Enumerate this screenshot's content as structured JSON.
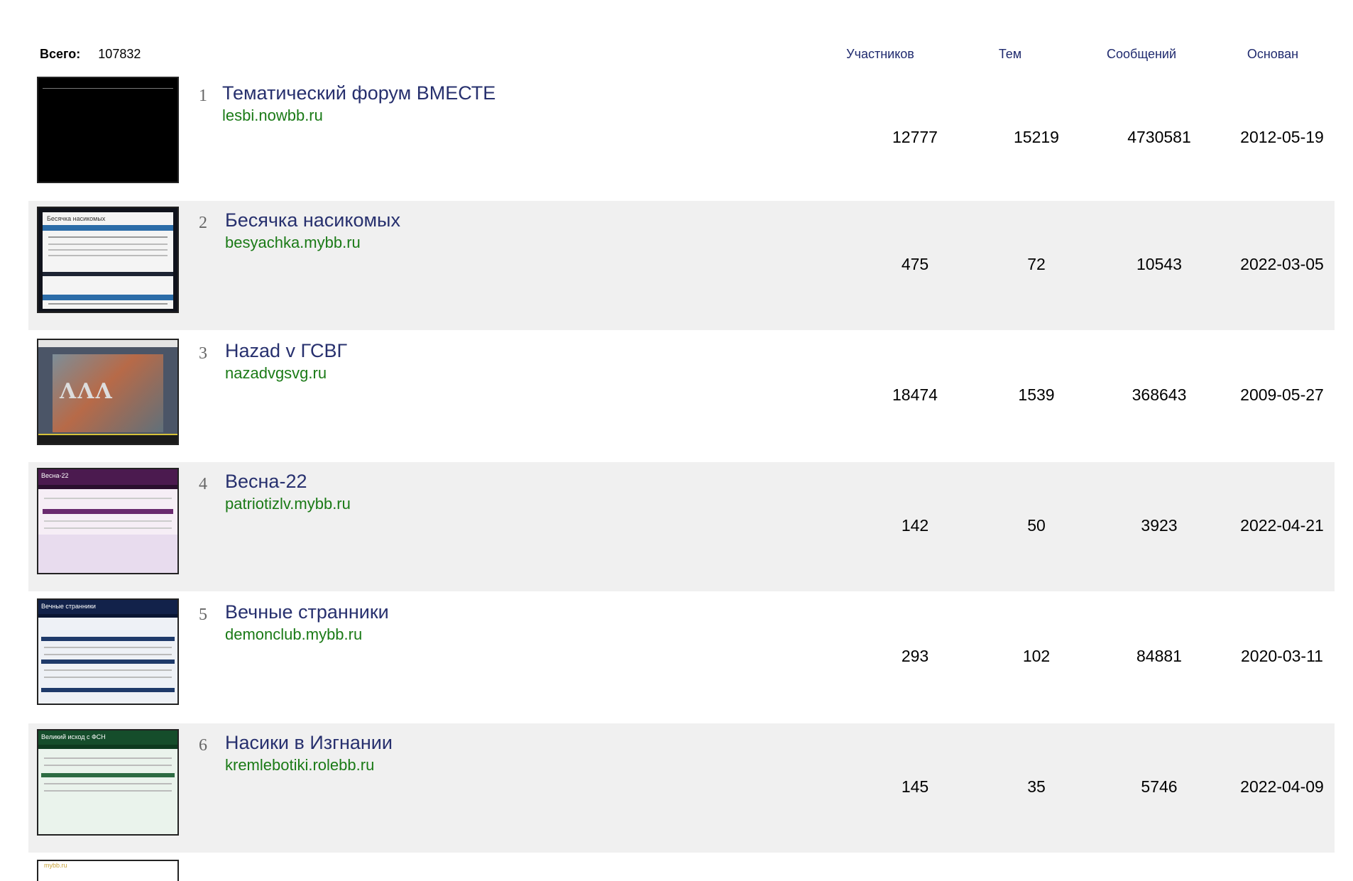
{
  "summary": {
    "label": "Всего:",
    "value": "107832"
  },
  "columns": {
    "members": "Участников",
    "topics": "Тем",
    "posts": "Сообщений",
    "founded": "Основан"
  },
  "forums": [
    {
      "rank": "1",
      "title": "Тематический форум ВМЕСТЕ",
      "domain": "lesbi.nowbb.ru",
      "members": "12777",
      "topics": "15219",
      "posts": "4730581",
      "founded": "2012-05-19"
    },
    {
      "rank": "2",
      "title": "Бесячка насикомых",
      "domain": "besyachka.mybb.ru",
      "members": "475",
      "topics": "72",
      "posts": "10543",
      "founded": "2022-03-05"
    },
    {
      "rank": "3",
      "title": "Hazad v ГСВГ",
      "domain": "nazadvgsvg.ru",
      "members": "18474",
      "topics": "1539",
      "posts": "368643",
      "founded": "2009-05-27"
    },
    {
      "rank": "4",
      "title": "Весна-22",
      "domain": "patriotizlv.mybb.ru",
      "members": "142",
      "topics": "50",
      "posts": "3923",
      "founded": "2022-04-21"
    },
    {
      "rank": "5",
      "title": "Вечные странники",
      "domain": "demonclub.mybb.ru",
      "members": "293",
      "topics": "102",
      "posts": "84881",
      "founded": "2020-03-11"
    },
    {
      "rank": "6",
      "title": "Насики в Изгнании",
      "domain": "kremlebotiki.rolebb.ru",
      "members": "145",
      "topics": "35",
      "posts": "5746",
      "founded": "2022-04-09"
    }
  ],
  "thumbs": {
    "t2_title": "Бесячка насикомых",
    "t4_title": "Весна-22",
    "t5_title": "Вечные странники",
    "t6_title": "Великий исход с ФСН",
    "t7_title": "mybb.ru"
  }
}
